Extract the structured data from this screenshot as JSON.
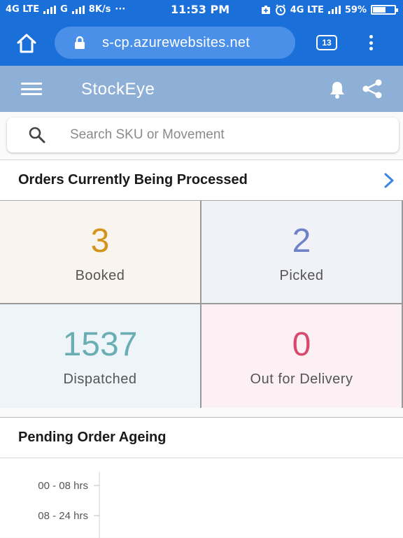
{
  "status_bar": {
    "network_left": "4G LTE",
    "network_g": "G",
    "speed": "8K/s",
    "dots": "···",
    "time": "11:53 PM",
    "network_right": "4G LTE",
    "battery": "59%",
    "battery_level": 0.59
  },
  "browser": {
    "url": "s-cp.azurewebsites.net",
    "tab_count": "13"
  },
  "app": {
    "title": "StockEye"
  },
  "search": {
    "placeholder": "Search SKU or Movement",
    "value": ""
  },
  "orders": {
    "title": "Orders Currently Being Processed",
    "tiles": [
      {
        "value": "3",
        "label": "Booked",
        "color": "#d4941c"
      },
      {
        "value": "2",
        "label": "Picked",
        "color": "#6f82c8"
      },
      {
        "value": "1537",
        "label": "Dispatched",
        "color": "#6aaeb4"
      },
      {
        "value": "0",
        "label": "Out for Delivery",
        "color": "#d9496f"
      }
    ]
  },
  "ageing": {
    "title": "Pending Order Ageing"
  },
  "chart_data": {
    "type": "bar",
    "orientation": "horizontal",
    "title": "",
    "categories": [
      "00 - 08 hrs",
      "08 - 24 hrs"
    ],
    "values": [],
    "grid": false
  },
  "colors": {
    "browser_bar": "#1a6fd8",
    "app_bar": "#8fb0d6",
    "link_chevron": "#3a86e8"
  }
}
